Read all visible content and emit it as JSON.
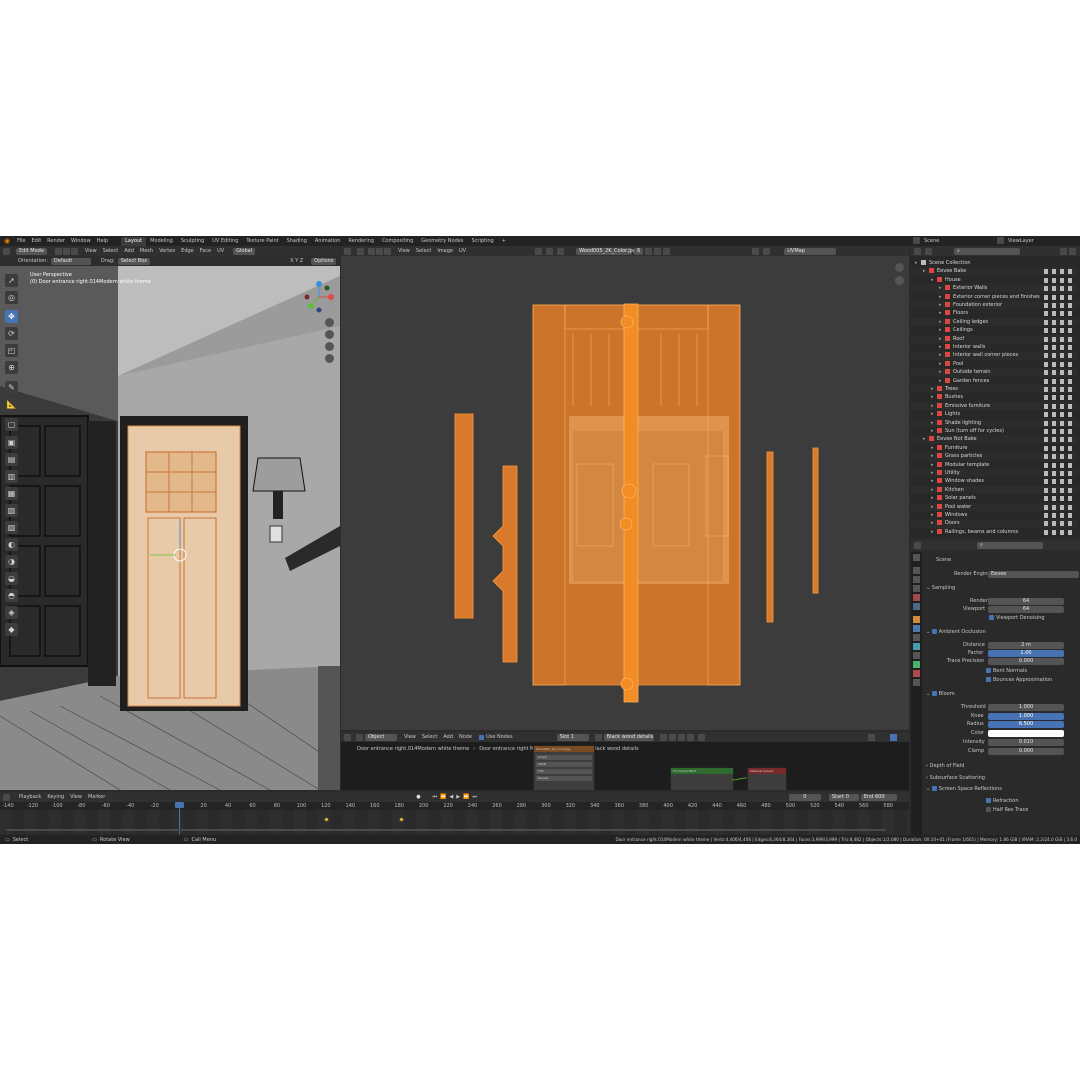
{
  "topbar": {
    "menus": [
      "File",
      "Edit",
      "Render",
      "Window",
      "Help"
    ],
    "workspaces": [
      "Layout",
      "Modeling",
      "Sculpting",
      "UV Editing",
      "Texture Paint",
      "Shading",
      "Animation",
      "Rendering",
      "Compositing",
      "Geometry Nodes",
      "Scripting",
      "+"
    ],
    "active_workspace": "Layout",
    "scene_name": "Scene",
    "view_layer": "ViewLayer"
  },
  "viewport3d": {
    "mode": "Edit Mode",
    "menus": [
      "View",
      "Select",
      "Add",
      "Mesh",
      "Vertex",
      "Edge",
      "Face",
      "UV"
    ],
    "transform": "Global",
    "orientation_label": "Orientation:",
    "orientation_value": "Default",
    "drag_label": "Drag:",
    "drag_value": "Select Box",
    "options_label": "Options",
    "axes": "X  Y  Z",
    "info_line1": "User Perspective",
    "info_line2": "(0) Door entrance right.014Modern white theme"
  },
  "uv_editor": {
    "menus": [
      "View",
      "Select",
      "Image",
      "UV"
    ],
    "image_name": "Wood005_2K_Color.jpg",
    "image_slot": "6",
    "uv_map": "UVMap"
  },
  "node_editor": {
    "type_label": "Object",
    "menus": [
      "View",
      "Select",
      "Add",
      "Node"
    ],
    "use_nodes_label": "Use Nodes",
    "slot": "Slot 1",
    "material": "Black wood details",
    "breadcrumb": [
      "Door entrance right.014Modern white theme",
      "Door entrance right Modern white theme",
      "Black wood details"
    ],
    "node_image_title": "Wood005_2K_Color.jpg",
    "node_bsdf_title": "Principled BSDF",
    "node_output_title": "Material Output",
    "node_rows": [
      "Linear",
      "sRGB",
      "Flat",
      "Repeat"
    ]
  },
  "outliner": {
    "search_placeholder": "",
    "items": [
      {
        "label": "Scene Collection",
        "depth": 0
      },
      {
        "label": "Eevee Bake",
        "depth": 1
      },
      {
        "label": "House",
        "depth": 2
      },
      {
        "label": "Exterior Walls",
        "depth": 3
      },
      {
        "label": "Exterior corner pieces and finishes",
        "depth": 3
      },
      {
        "label": "Foundation exterior",
        "depth": 3
      },
      {
        "label": "Floors",
        "depth": 3
      },
      {
        "label": "Ceiling ledges",
        "depth": 3
      },
      {
        "label": "Ceilings",
        "depth": 3
      },
      {
        "label": "Roof",
        "depth": 3
      },
      {
        "label": "Interior walls",
        "depth": 3
      },
      {
        "label": "Interior wall corner pieces",
        "depth": 3
      },
      {
        "label": "Pool",
        "depth": 3
      },
      {
        "label": "Outside terrain",
        "depth": 3
      },
      {
        "label": "Garden fences",
        "depth": 3
      },
      {
        "label": "Trees",
        "depth": 2
      },
      {
        "label": "Bushes",
        "depth": 2
      },
      {
        "label": "Emissive furniture",
        "depth": 2
      },
      {
        "label": "Lights",
        "depth": 2
      },
      {
        "label": "Shade lighting",
        "depth": 2
      },
      {
        "label": "Sun (turn off for cycles)",
        "depth": 2
      },
      {
        "label": "Eevee Not Bake",
        "depth": 1
      },
      {
        "label": "Furniture",
        "depth": 2
      },
      {
        "label": "Grass particles",
        "depth": 2
      },
      {
        "label": "Modular template",
        "depth": 2
      },
      {
        "label": "Utility",
        "depth": 2
      },
      {
        "label": "Window shades",
        "depth": 2
      },
      {
        "label": "Kitchen",
        "depth": 2
      },
      {
        "label": "Solar panels",
        "depth": 2
      },
      {
        "label": "Pool water",
        "depth": 2
      },
      {
        "label": "Windows",
        "depth": 2
      },
      {
        "label": "Doors",
        "depth": 2
      },
      {
        "label": "Railings, beams and columns",
        "depth": 2
      }
    ]
  },
  "properties": {
    "context": "Scene",
    "render_engine_label": "Render Engine",
    "render_engine_value": "Eevee",
    "sampling": {
      "title": "Sampling",
      "render_label": "Render",
      "render_value": "64",
      "viewport_label": "Viewport",
      "viewport_value": "64",
      "denoise_label": "Viewport Denoising"
    },
    "ao": {
      "title": "Ambient Occlusion",
      "distance_label": "Distance",
      "distance_value": "2 m",
      "factor_label": "Factor",
      "factor_value": "1.00",
      "trace_label": "Trace Precision",
      "trace_value": "0.000",
      "bent_label": "Bent Normals",
      "bounce_label": "Bounces Approximation"
    },
    "bloom": {
      "title": "Bloom",
      "threshold_label": "Threshold",
      "threshold_value": "1.000",
      "knee_label": "Knee",
      "knee_value": "1.000",
      "radius_label": "Radius",
      "radius_value": "6.500",
      "color_label": "Color",
      "intensity_label": "Intensity",
      "intensity_value": "0.010",
      "clamp_label": "Clamp",
      "clamp_value": "0.000"
    },
    "dof_title": "Depth of Field",
    "sss_title": "Subsurface Scattering",
    "ssr": {
      "title": "Screen Space Reflections",
      "refraction_label": "Refraction",
      "halfres_label": "Half Res Trace"
    }
  },
  "timeline": {
    "menus": [
      "Playback",
      "Keying",
      "View",
      "Marker"
    ],
    "current_frame": "0",
    "start_label": "Start",
    "start_value": "0",
    "end_label": "End",
    "end_value": "600",
    "ticks": [
      "-140",
      "-120",
      "-100",
      "-80",
      "-60",
      "-40",
      "-20",
      "0",
      "20",
      "40",
      "60",
      "80",
      "100",
      "120",
      "140",
      "160",
      "180",
      "200",
      "220",
      "240",
      "260",
      "280",
      "300",
      "320",
      "340",
      "360",
      "380",
      "400",
      "420",
      "440",
      "460",
      "480",
      "500",
      "520",
      "540",
      "560",
      "580"
    ]
  },
  "statusbar": {
    "left1": "Select",
    "left2": "Rotate View",
    "left3": "Call Menu",
    "right": "Door entrance right.014Modern white theme | Verts:4,406/4,406 | Edges:8,364/8,364 | Faces:3,999/3,999 | Tris:8,482 | Objects:1/2,080 | Duration: 00:10+01 (Frame 1/601) | Memory: 1.86 GiB | VRAM: 2.2/24.0 GiB | 3.6.0"
  },
  "colors": {
    "accent": "#4772b3",
    "uv_orange": "#e07a2a",
    "bg": "#2b2b2b"
  }
}
